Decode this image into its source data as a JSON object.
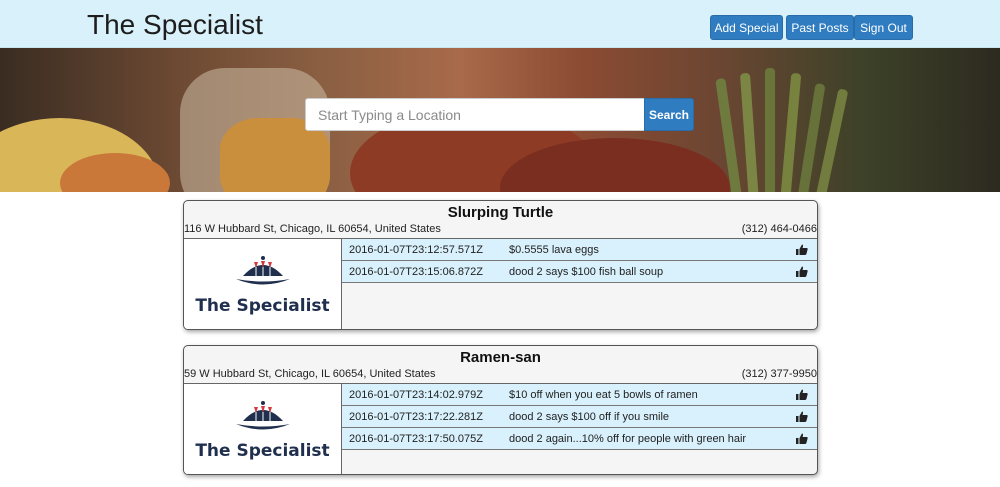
{
  "header": {
    "brand": "The Specialist",
    "add_special_label": "Add Special",
    "past_posts_label": "Past Posts",
    "sign_out_label": "Sign Out"
  },
  "search": {
    "placeholder": "Start Typing a Location",
    "button_label": "Search"
  },
  "restaurants": [
    {
      "name": "Slurping Turtle",
      "address": "116 W Hubbard St, Chicago, IL 60654, United States",
      "phone": "(312) 464-0466",
      "logo_text": "The Specialist",
      "posts": [
        {
          "timestamp": "2016-01-07T23:12:57.571Z",
          "text": "$0.5555 lava eggs"
        },
        {
          "timestamp": "2016-01-07T23:15:06.872Z",
          "text": "dood 2 says $100 fish ball soup"
        }
      ]
    },
    {
      "name": "Ramen-san",
      "address": "59 W Hubbard St, Chicago, IL 60654, United States",
      "phone": "(312) 377-9950",
      "logo_text": "The Specialist",
      "posts": [
        {
          "timestamp": "2016-01-07T23:14:02.979Z",
          "text": "$10 off when you eat 5 bowls of ramen"
        },
        {
          "timestamp": "2016-01-07T23:17:22.281Z",
          "text": "dood 2 says $100 off if you smile"
        },
        {
          "timestamp": "2016-01-07T23:17:50.075Z",
          "text": "dood 2 again...10% off for people with green hair"
        }
      ]
    }
  ],
  "colors": {
    "navbar_bg": "#d9f1fb",
    "primary_button": "#2f7cc0",
    "post_row_bg": "#d8f1fc",
    "logo_navy": "#1f2f4d",
    "logo_red": "#d4383f"
  }
}
